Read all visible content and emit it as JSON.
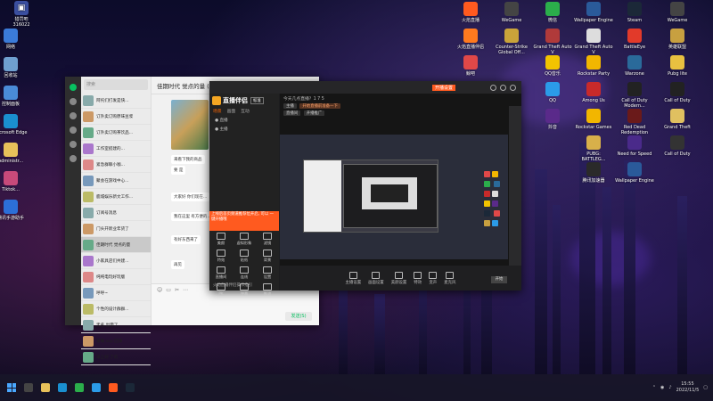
{
  "desktop": {
    "top_left": {
      "label": "猎罚吧",
      "code": "316022"
    },
    "left_icons": [
      {
        "label": "网络",
        "icon": "network-icon",
        "color": "#3b7bd8"
      },
      {
        "label": "回收站",
        "icon": "recycle-bin-icon",
        "color": "#6f9fcf"
      },
      {
        "label": "控制面板",
        "icon": "control-panel-icon",
        "color": "#4a8bd8"
      },
      {
        "label": "Microsoft Edge",
        "icon": "edge-icon",
        "color": "#1a8fd0"
      },
      {
        "label": "Administr...",
        "icon": "folder-icon",
        "color": "#e8c15a"
      },
      {
        "label": "Tiktok...",
        "icon": "anime-app-icon",
        "color": "#c84a7a"
      },
      {
        "label": "腾讯手游助手",
        "icon": "game-assistant-icon",
        "color": "#2c6fd8"
      }
    ],
    "right_col1": [
      {
        "label": "火焰直播",
        "icon": "fire-live-icon",
        "color": "#ff5a1f"
      },
      {
        "label": "火焰直播伴侣",
        "icon": "fire-live-companion-icon",
        "color": "#ff7a1f"
      },
      {
        "label": "鲸吧",
        "icon": "whale-icon",
        "color": "#e04848"
      }
    ],
    "right_col2": [
      {
        "label": "WeGame",
        "icon": "wegame-icon",
        "color": "#444"
      },
      {
        "label": "Counter-Strike Global Off...",
        "icon": "csgo-icon",
        "color": "#c9a33a"
      }
    ],
    "right_col3": [
      {
        "label": "微信",
        "icon": "wechat-icon",
        "color": "#2bae4b"
      },
      {
        "label": "Grand Theft Auto V",
        "icon": "gta-icon",
        "color": "#b03a3a"
      },
      {
        "label": "QQ音乐",
        "icon": "qq-music-icon",
        "color": "#f2c300"
      },
      {
        "label": "QQ",
        "icon": "qq-icon",
        "color": "#2b9be8"
      },
      {
        "label": "抖音",
        "icon": "douyin-icon",
        "color": "#5a2a8a"
      }
    ],
    "right_col4": [
      {
        "label": "Wallpaper Engine",
        "icon": "wallpaper-engine-icon",
        "color": "#2a5a9a"
      },
      {
        "label": "Grand Theft Auto V",
        "icon": "gta-icon",
        "color": "#ddd"
      },
      {
        "label": "Rockstar Party",
        "icon": "rockstar-icon",
        "color": "#f2b600"
      },
      {
        "label": "Among Us",
        "icon": "among-us-icon",
        "color": "#c82a2a"
      },
      {
        "label": "Rockstar Games",
        "icon": "rockstar-games-icon",
        "color": "#f2b600"
      },
      {
        "label": "PUBG: BATTLEG...",
        "icon": "pubg-icon",
        "color": "#d8b04a"
      },
      {
        "label": "腾讯加速器",
        "icon": "accelerator-icon",
        "color": "#2a2a2a"
      }
    ],
    "right_col5": [
      {
        "label": "Steam",
        "icon": "steam-icon",
        "color": "#1b2838"
      },
      {
        "label": "BattleEye",
        "icon": "battleeye-icon",
        "color": "#e23a2a"
      },
      {
        "label": "Warzone",
        "icon": "warzone-icon",
        "color": "#2a6a9a"
      },
      {
        "label": "Call of Duty Modern...",
        "icon": "cod-icon",
        "color": "#222"
      },
      {
        "label": "Red Dead Redemption",
        "icon": "rdr-icon",
        "color": "#6a1a1a"
      },
      {
        "label": "Need for Speed",
        "icon": "nfs-icon",
        "color": "#4a2a8a"
      },
      {
        "label": "Wallpaper Engine",
        "icon": "wallpaper-icon",
        "color": "#2a5a9a"
      }
    ],
    "right_col6": [
      {
        "label": "WeGame",
        "icon": "wegame2-icon",
        "color": "#444"
      },
      {
        "label": "英雄联盟",
        "icon": "lol-icon",
        "color": "#c8a040"
      },
      {
        "label": "Pubg lite",
        "icon": "pubg-lite-icon",
        "color": "#e8c040"
      },
      {
        "label": "Call of Duty",
        "icon": "cod2-icon",
        "color": "#222"
      },
      {
        "label": "Grand Theft",
        "icon": "gta2-icon",
        "color": "#e0c060"
      },
      {
        "label": "Call of Duty",
        "icon": "cod3-icon",
        "color": "#333"
      }
    ]
  },
  "wechat": {
    "search_placeholder": "搜索",
    "chats": [
      "阿托们打发是快...",
      "订外卖订购原味豆浆",
      "订外卖订购茶饮品...",
      "工作室搭建的...",
      "紧急群聊小咖...",
      "聚会在游戏中心...",
      "鹿城娱乐新文工作...",
      "订阅号消息",
      "门头开新业年货了",
      "佳期时代 觉点的量",
      "小家具店们共建...",
      "纯纯电玩好玩版",
      "呼呼~",
      "个性的设计群群...",
      "无名 出零了",
      "早睡 sop 回来",
      "早上好 了的"
    ],
    "chat_title": "佳期时代  觉点的量 (376)",
    "messages": [
      "来看下我的商品",
      "要 是",
      "大家好 你们现在...",
      "我在这里 有方便的...",
      "有好东西来了",
      "再见"
    ],
    "send_label": "发送(S)"
  },
  "live": {
    "brand": "直播伴侣",
    "brand_tag": "标准",
    "top_tab": "开播设置",
    "tabs": [
      "场景",
      "画面",
      "互动"
    ],
    "rows": [
      "● 直播",
      "● 主播"
    ],
    "header_text": "今天几点直播？1 7 5",
    "chips": [
      "主播",
      "开始直播前准备一下"
    ],
    "chips2": [
      "直播间",
      "开播推广"
    ],
    "notice": "上线后首页频道推荐位开启, 可以 一键开播哦",
    "tools": [
      "美颜",
      "虚拟形象",
      "滤镜",
      "特效",
      "贴纸",
      "背景",
      "直播间",
      "连线",
      "设置",
      "PK",
      "弹幕",
      "推流"
    ],
    "tools_bottom": "火焰直播伴侣操作指引",
    "toolbar": [
      "主播设置",
      "画面设置",
      "美颜设置",
      "特效",
      "变声",
      "麦克风"
    ],
    "start": "开始",
    "colors": {
      "accent": "#ff5a1f"
    }
  },
  "taskbar": {
    "time": "15:55",
    "date": "2022/11/5"
  }
}
